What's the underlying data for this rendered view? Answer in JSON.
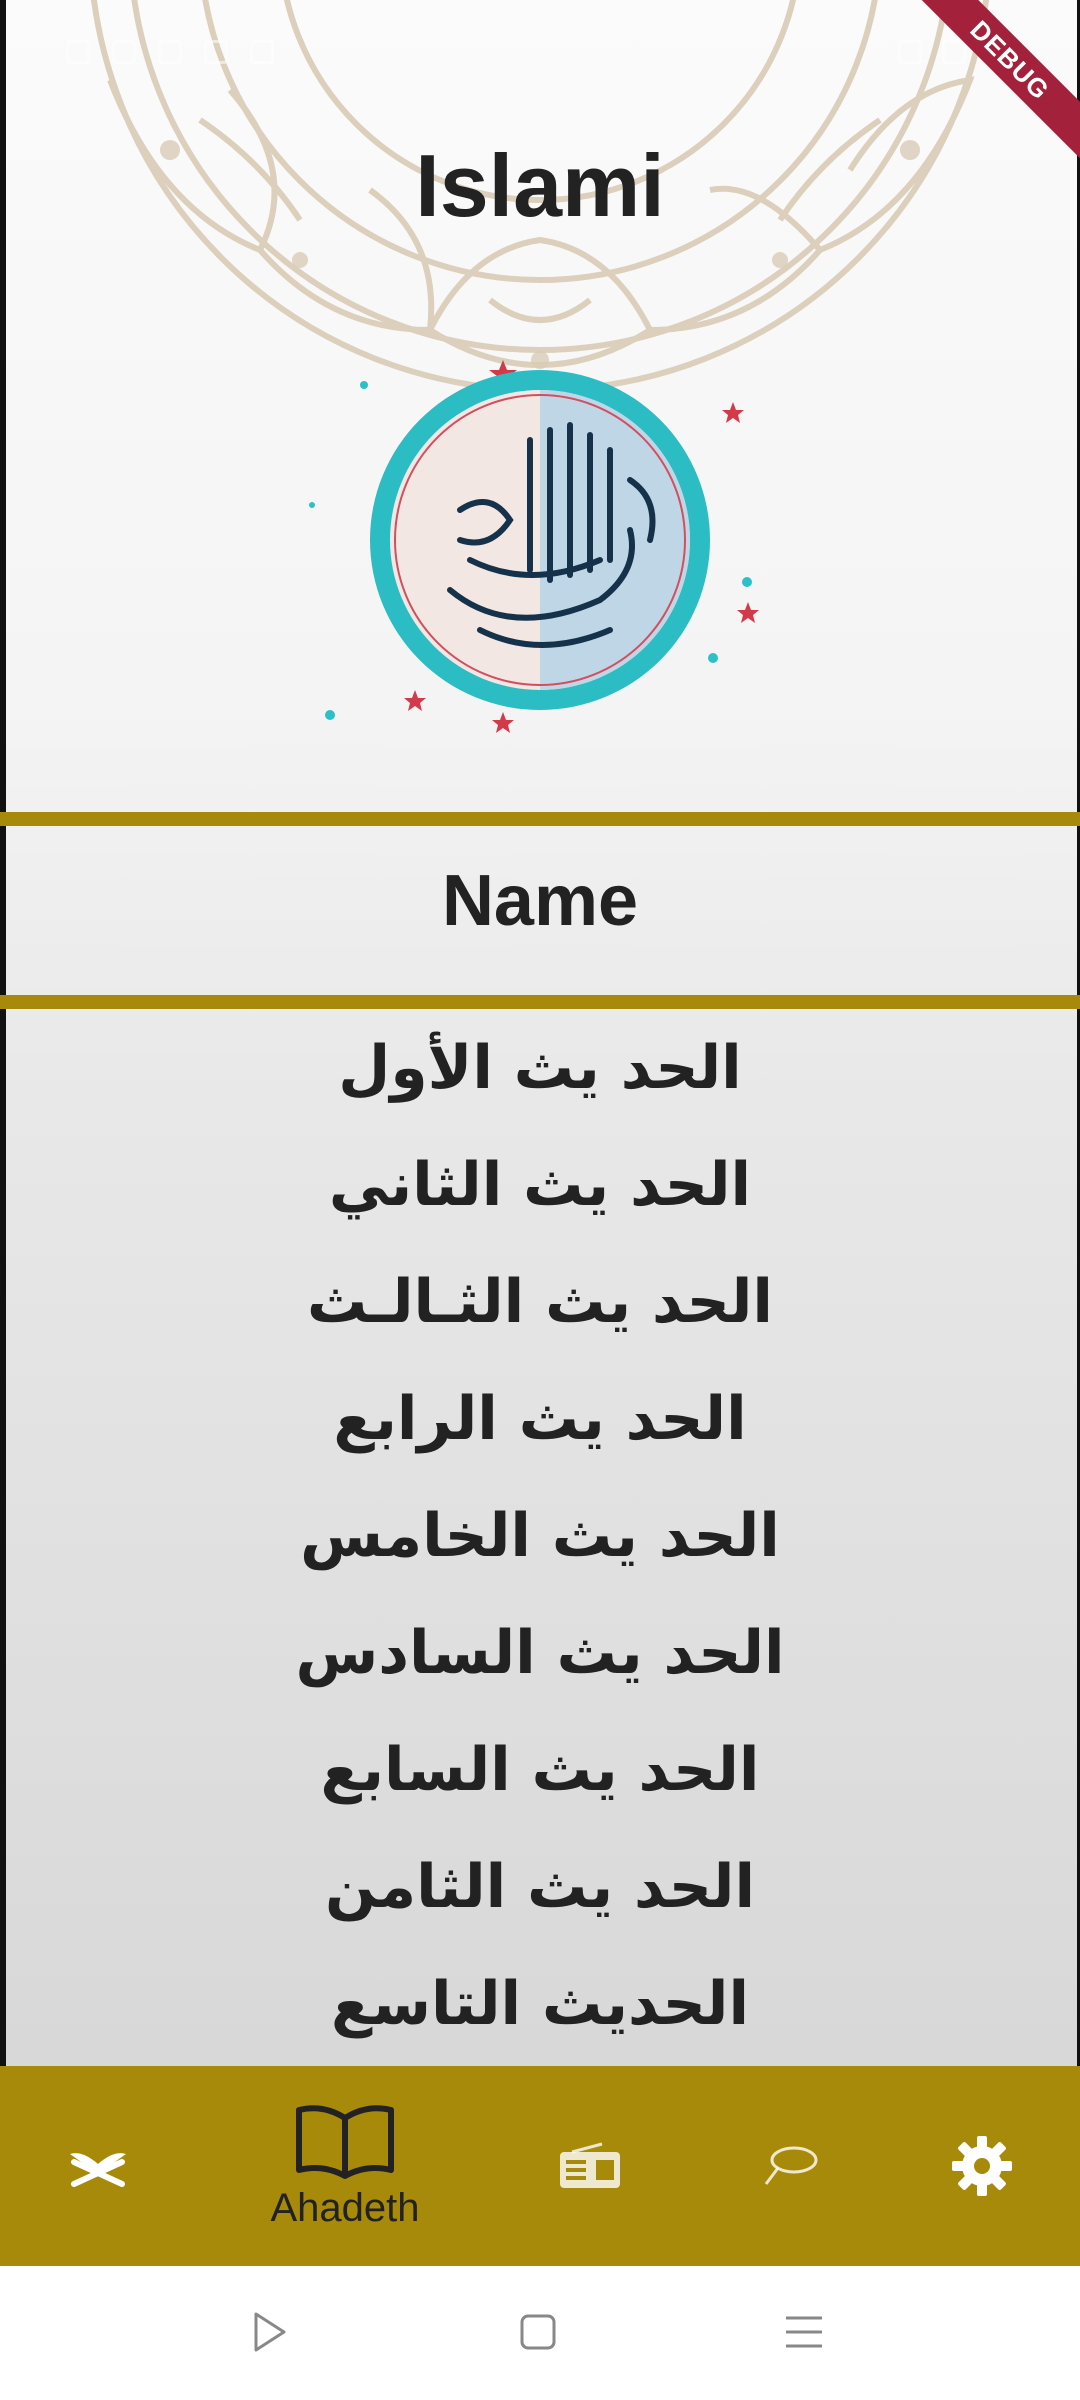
{
  "app": {
    "title": "Islami",
    "debug_label": "DEBUG",
    "colors": {
      "accent": "#a88a0a",
      "text": "#222222",
      "debug": "#a3213a"
    }
  },
  "table": {
    "header": "Name",
    "items": [
      "الحد يث الأول",
      "الحد يث الثاني",
      "الحد يث الثـالـث",
      "الحد يث الرابع",
      "الحد يث الخامس",
      "الحد يث السادس",
      "الحد يث السابع",
      "الحد يث الثامن",
      "الحديث التاسع"
    ]
  },
  "bottom_nav": {
    "items": [
      {
        "icon": "quran-icon",
        "label": ""
      },
      {
        "icon": "book-icon",
        "label": "Ahadeth",
        "selected": true
      },
      {
        "icon": "radio-icon",
        "label": ""
      },
      {
        "icon": "sebha-icon",
        "label": ""
      },
      {
        "icon": "gear-icon",
        "label": ""
      }
    ]
  },
  "system_nav": {
    "icons": [
      "back-triangle-icon",
      "home-square-icon",
      "menu-lines-icon"
    ]
  }
}
